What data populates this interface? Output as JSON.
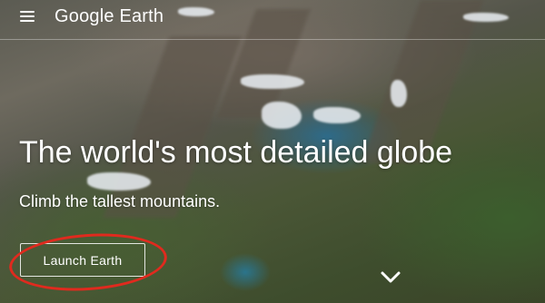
{
  "header": {
    "brand": "Google Earth",
    "menu_icon": "hamburger-menu-icon"
  },
  "hero": {
    "headline": "The world's most detailed globe",
    "subhead": "Climb the tallest mountains.",
    "launch_label": "Launch Earth",
    "scroll_icon": "chevron-down-icon"
  },
  "annotation": {
    "shape": "ellipse",
    "color": "#e02a1e",
    "target": "launch-earth-button"
  }
}
